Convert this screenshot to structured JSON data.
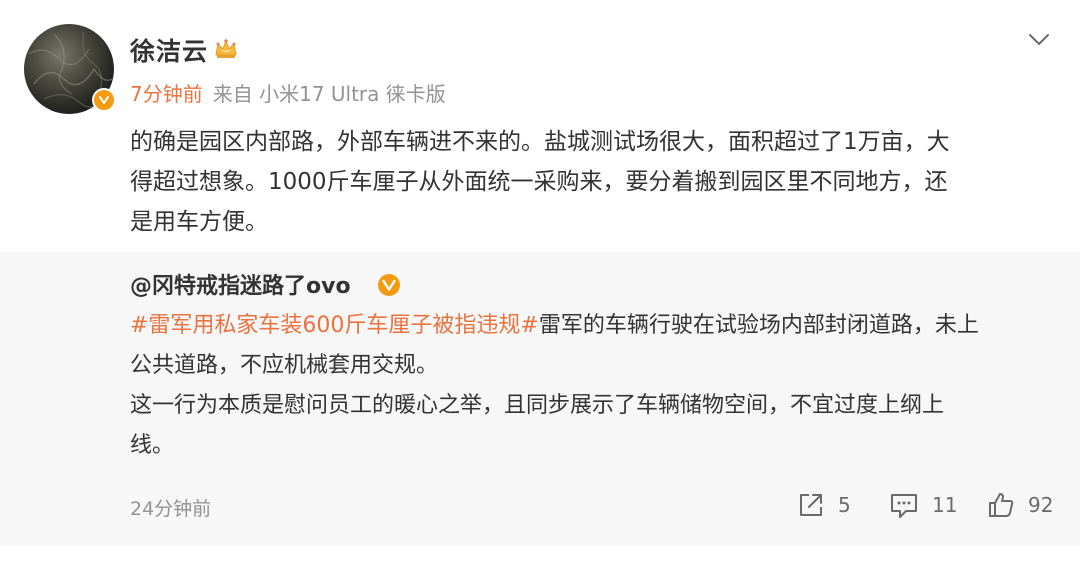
{
  "post": {
    "username": "徐洁云",
    "time": "7分钟前",
    "source": "来自 小米17 Ultra 徕卡版",
    "text_lines": [
      "的确是园区内部路，外部车辆进不来的。盐城测试场很大，面积超过了1万亩，大",
      "得超过想象。1000斤车厘子从外面统一采购来，要分着搬到园区里不同地方，还",
      "是用车方便。"
    ],
    "icons": {
      "avatar": "avatar",
      "verified": "verified-badge-icon",
      "crown": "crown-icon",
      "menu": "chevron-down-icon"
    }
  },
  "repost": {
    "author": "@冈特戒指迷路了ovo",
    "topic": "#雷军用私家车装600斤车厘子被指违规#",
    "line1_rest": "雷军的车辆行驶在试验场内部封闭道路，未上",
    "line2": "公共道路，不应机械套用交规。",
    "line3": "这一行为本质是慰问员工的暖心之举，且同步展示了车辆储物空间，不宜过度上纲上",
    "line4": "线。",
    "time": "24分钟前"
  },
  "actions": {
    "repost_count": "5",
    "comment_count": "11",
    "like_count": "92",
    "icons": [
      "share-icon",
      "comment-icon",
      "like-icon"
    ]
  },
  "colors": {
    "accent": "#eb7340",
    "meta": "#939393",
    "repost_bg": "#f7f7f7",
    "badge": "#f39c12"
  }
}
